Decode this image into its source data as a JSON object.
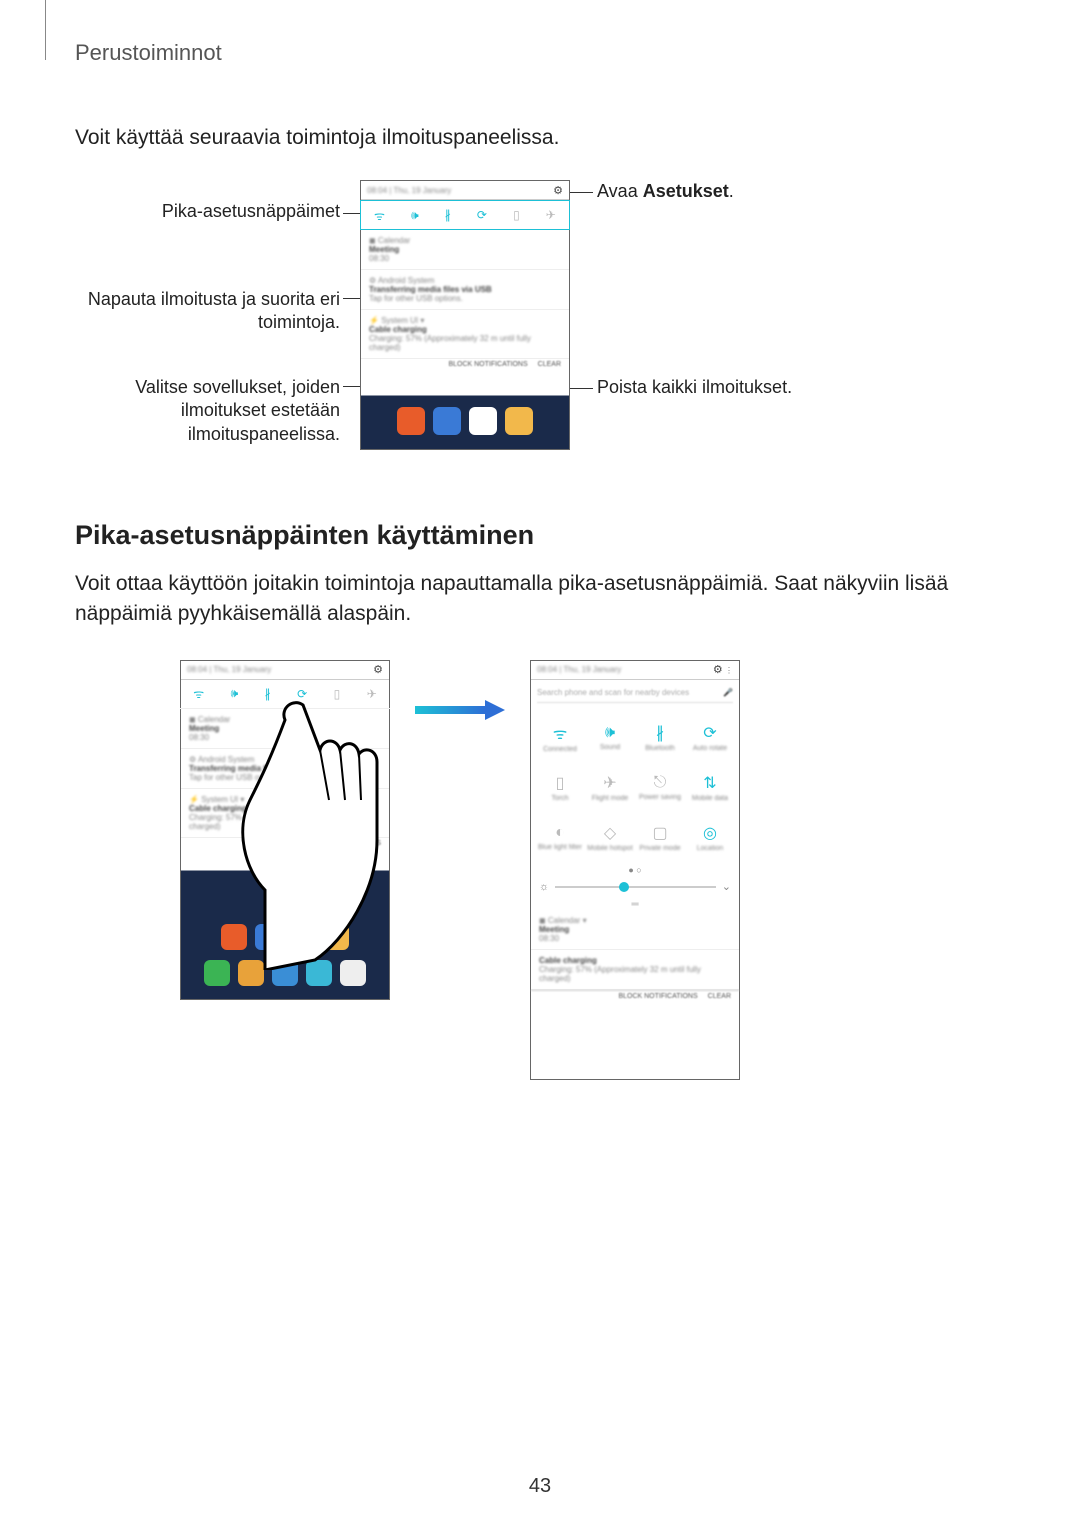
{
  "header": {
    "title": "Perustoiminnot"
  },
  "intro": "Voit käyttää seuraavia toimintoja ilmoituspaneelissa.",
  "callouts": {
    "left1": "Pika-asetusnäppäimet",
    "left2": "Napauta ilmoitusta ja suorita eri toimintoja.",
    "left3": "Valitse sovellukset, joiden ilmoitukset estetään ilmoituspaneelissa.",
    "right1_pre": "Avaa ",
    "right1_bold": "Asetukset",
    "right1_post": ".",
    "right2": "Poista kaikki ilmoitukset."
  },
  "section2": {
    "heading": "Pika-asetusnäppäinten käyttäminen",
    "body": "Voit ottaa käyttöön joitakin toimintoja napauttamalla pika-asetusnäppäimiä. Saat näkyviin lisää näppäimiä pyyhkäisemällä alaspäin."
  },
  "phone": {
    "time": "08:04",
    "date": "Thu, 19 January",
    "qs_icons": [
      "wifi",
      "sound",
      "bluetooth",
      "rotate",
      "torch",
      "airplane"
    ],
    "notif1": {
      "app": "Calendar",
      "title": "Meeting",
      "time": "08:30"
    },
    "notif2": {
      "app": "Android System",
      "title": "Transferring media files via USB",
      "sub": "Tap for other USB options."
    },
    "notif3": {
      "app": "System UI",
      "title": "Cable charging",
      "sub": "Charging: 57% (Approximately 32 m until fully charged)"
    },
    "block_btn": "BLOCK NOTIFICATIONS",
    "clear_btn": "CLEAR"
  },
  "phoneB": {
    "search": "Search phone and scan for nearby devices",
    "grid_labels": [
      "Connected",
      "Sound",
      "Bluetooth",
      "Auto rotate",
      "Torch",
      "Flight mode",
      "Power saving",
      "Mobile data",
      "Blue light filter",
      "Mobile hotspot",
      "Private mode",
      "Location"
    ]
  },
  "pageNumber": "43"
}
